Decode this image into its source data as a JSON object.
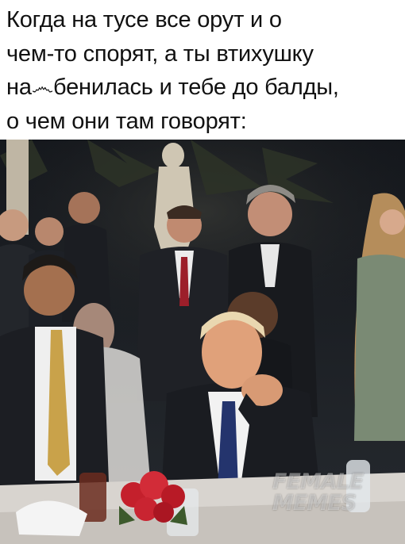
{
  "caption": {
    "lines": [
      "Когда на тусе все орут и о",
      "чем-то спорят, а ты втихушку",
      "на෴бенилась и тебе до балды,",
      "о чем они там говорят:"
    ]
  },
  "watermark": {
    "line1": "FEMALE",
    "line2": "MEMES"
  },
  "colors": {
    "background": "#ffffff",
    "text": "#111111",
    "night_sky": "#171a1f",
    "tablecloth": "#d8d4cf",
    "roses": "#c4202c"
  }
}
